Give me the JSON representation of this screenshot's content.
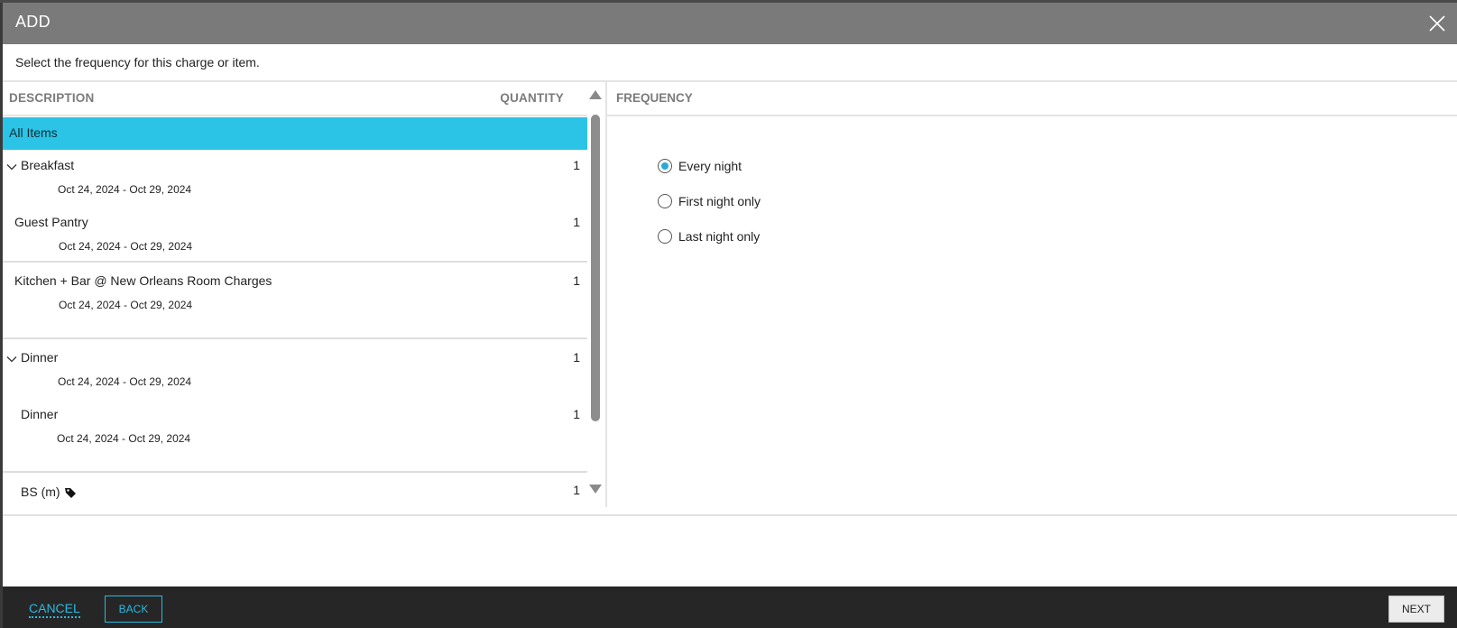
{
  "dialog": {
    "title": "ADD",
    "instruction": "Select the frequency for this charge or item."
  },
  "list": {
    "col_description": "DESCRIPTION",
    "col_quantity": "QUANTITY",
    "all_items_label": "All Items",
    "rows": [
      {
        "label": "Breakfast",
        "qty": "1",
        "date": "Oct 24, 2024 - Oct 29, 2024",
        "expandable": true
      },
      {
        "label": "Guest Pantry",
        "qty": "1",
        "date": "Oct 24, 2024 - Oct 29, 2024",
        "expandable": false
      },
      {
        "label": "Kitchen + Bar @ New Orleans Room Charges",
        "qty": "1",
        "date": "Oct 24, 2024 - Oct 29, 2024",
        "expandable": false
      },
      {
        "label": "Dinner",
        "qty": "1",
        "date": "Oct 24, 2024 - Oct 29, 2024",
        "expandable": true
      },
      {
        "label": "Dinner",
        "qty": "1",
        "date": "Oct 24, 2024 - Oct 29, 2024",
        "expandable": false
      },
      {
        "label": "BS (m)",
        "qty": "1",
        "date": "",
        "expandable": false,
        "icon": "tag-icon"
      }
    ]
  },
  "frequency": {
    "heading": "FREQUENCY",
    "options": [
      {
        "label": "Every night",
        "checked": true
      },
      {
        "label": "First night only",
        "checked": false
      },
      {
        "label": "Last night only",
        "checked": false
      }
    ]
  },
  "footer": {
    "cancel_label": "CANCEL",
    "back_label": "BACK",
    "next_label": "NEXT"
  },
  "colors": {
    "header_bg": "#7a7a7a",
    "selected_row": "#2bc4e6",
    "accent": "#2bb9e0",
    "footer_bg": "#262626"
  }
}
